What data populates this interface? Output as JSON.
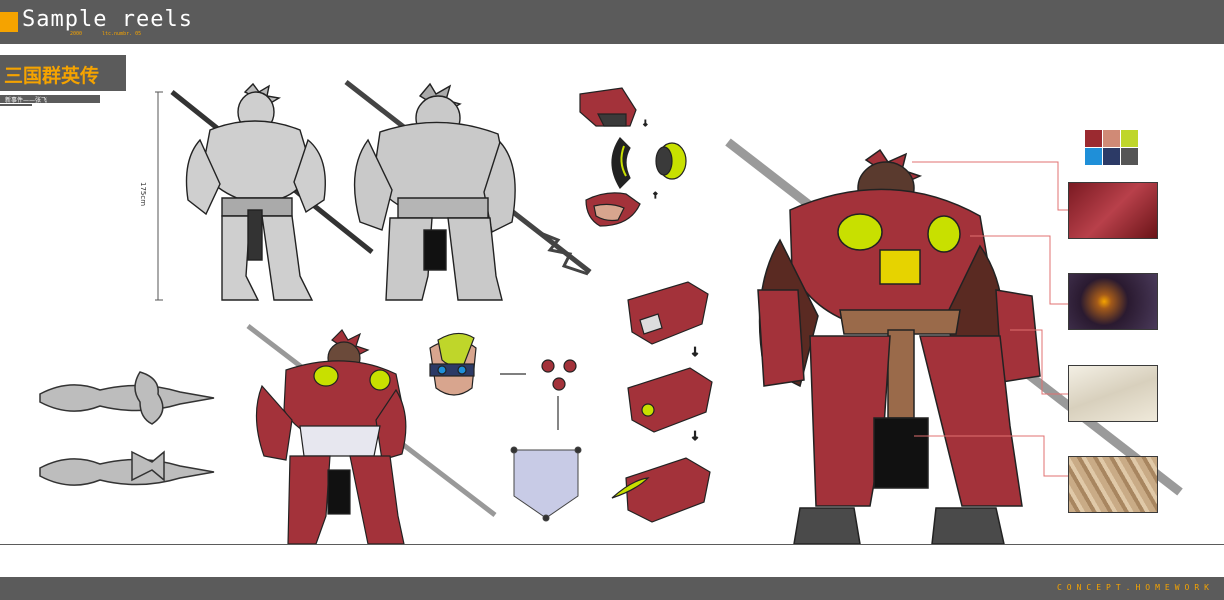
{
  "header": {
    "title": "Sample reels",
    "subtitle_left": "2000",
    "subtitle_right": "ltc.numbr. 05"
  },
  "section": {
    "title": "三国群英传",
    "subtitle": "新事件——张飞"
  },
  "sketch": {
    "height_label": "175cm"
  },
  "palette": {
    "colors": [
      "#9b2a30",
      "#d08a76",
      "#bfd62a",
      "#1f8fd8",
      "#2c3a66",
      "#555555"
    ]
  },
  "footer": {
    "text": "CONCEPT.HOMEWORK"
  },
  "colors": {
    "bar": "#5b5b5b",
    "accent": "#f5a300",
    "armor_red": "#a3323a",
    "armor_dark": "#5a2a22",
    "eye_green": "#c8e000",
    "sketch_gray": "#c9c9c9"
  }
}
